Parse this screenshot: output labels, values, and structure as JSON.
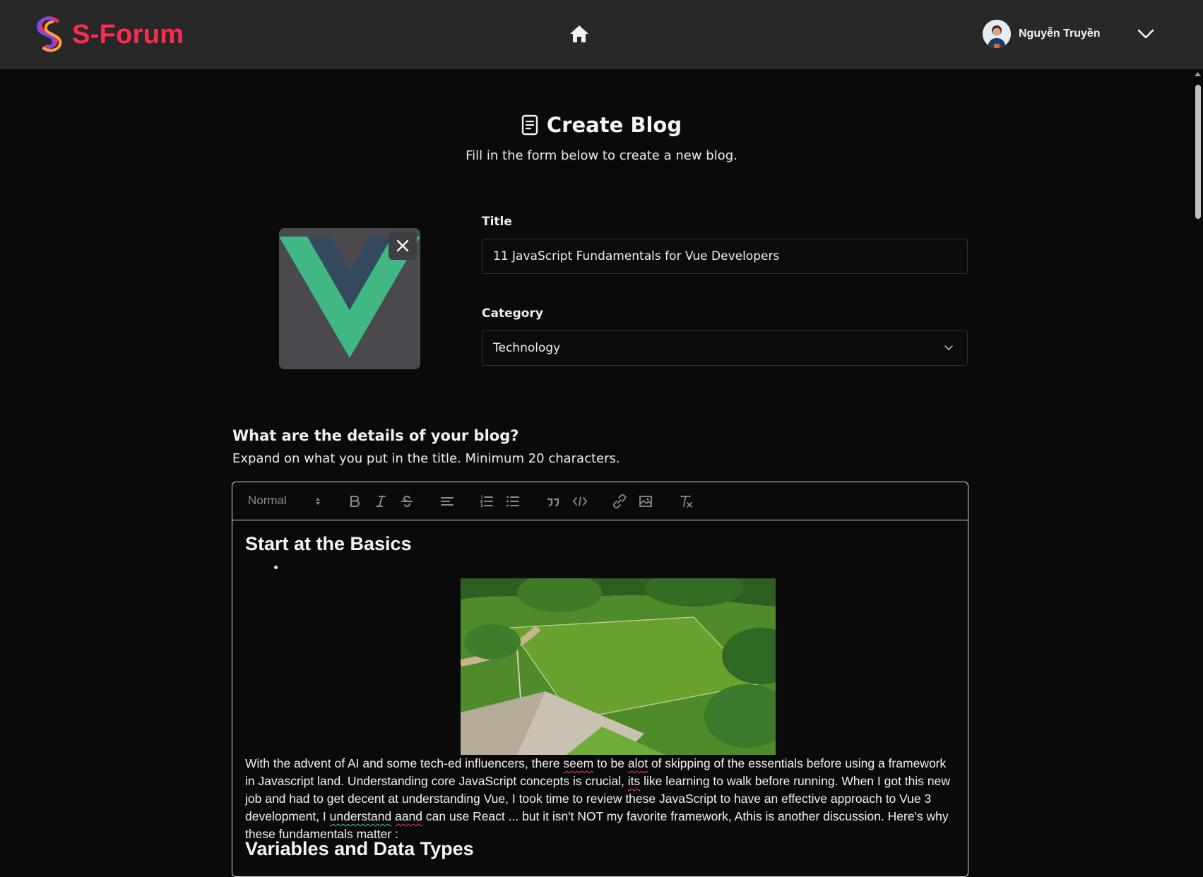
{
  "app": {
    "name": "S-Forum",
    "brand_color": "#ff2b4f"
  },
  "nav": {
    "home_icon": "home-icon",
    "user_name": "Nguyễn Truyền",
    "dropdown_icon": "chevron-down-icon"
  },
  "header": {
    "title": "Create Blog",
    "subtitle": "Fill in the form below to create a new blog."
  },
  "form": {
    "title_label": "Title",
    "title_value": "11 JavaScript Fundamentals for Vue Developers",
    "category_label": "Category",
    "category_value": "Technology",
    "details_title": "What are the details of your blog?",
    "details_subtitle": "Expand on what you put in the title. Minimum 20 characters."
  },
  "editor": {
    "format_select": "Normal",
    "toolbar": [
      "bold",
      "italic",
      "strike",
      "align",
      "ordered-list",
      "bullet-list",
      "blockquote",
      "code-block",
      "link",
      "image",
      "clean"
    ],
    "heading_1": "Start at the Basics",
    "paragraph": {
      "p1": "With the advent of AI and some tech-ed influencers, there ",
      "w1": "seem",
      "p2": " to be ",
      "w2": "alot",
      "p3": " of skipping of the essentials before using a framework in Javascript land. Understanding core JavaScript concepts is crucial, ",
      "w3": "its",
      "p4": " like learning to walk before running. When I got this new job and had to get decent at understanding Vue, I took time to review these JavaScript to have an effective approach to Vue 3 development, I ",
      "w4": "understand",
      "p5": " ",
      "w5": "aand",
      "p6": " can use React ... but it isn't NOT my favorite framework, Athis is another discussion. Here's why these fundamentals matter :"
    },
    "heading_2": "Variables and Data Types"
  }
}
